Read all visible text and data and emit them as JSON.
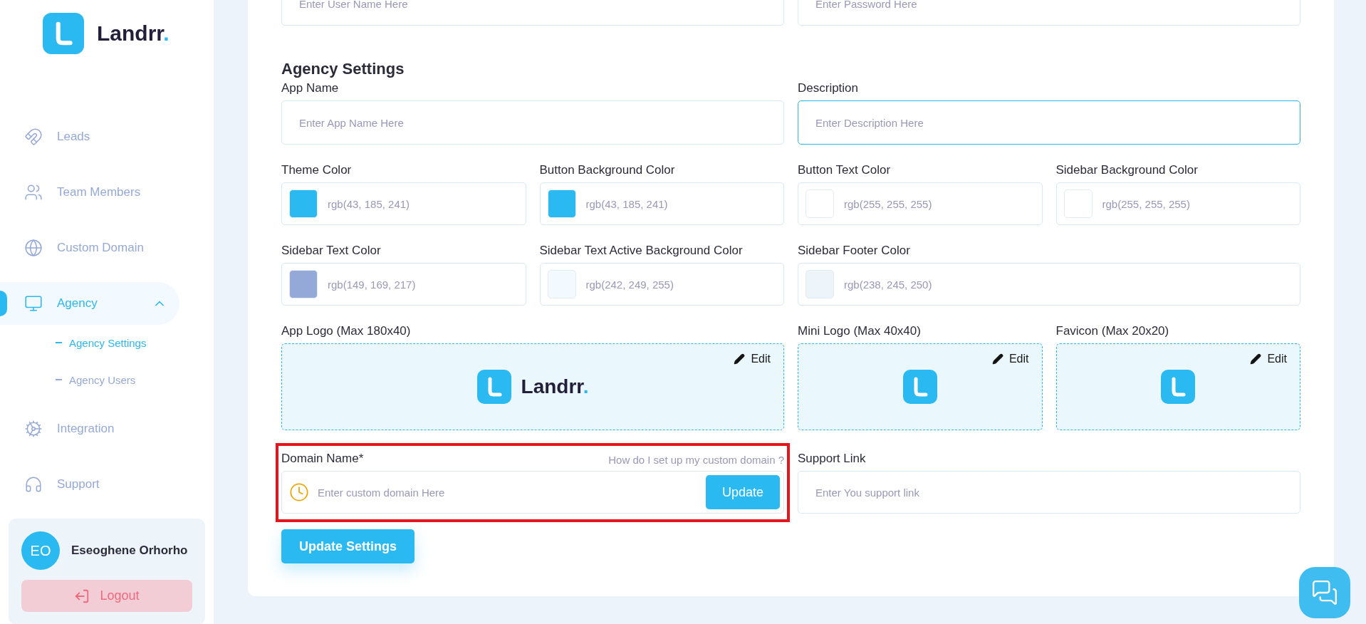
{
  "sidebar": {
    "brand": "Landrr",
    "brand_mark": ".",
    "items": [
      {
        "label": "Leads",
        "selected": false
      },
      {
        "label": "Team Members",
        "selected": false
      },
      {
        "label": "Custom Domain",
        "selected": false
      },
      {
        "label": "Agency",
        "selected": true,
        "expanded": true,
        "children": [
          {
            "label": "Agency Settings",
            "selected": true
          },
          {
            "label": "Agency Users",
            "selected": false
          }
        ]
      },
      {
        "label": "Integration",
        "selected": false
      },
      {
        "label": "Support",
        "selected": false
      }
    ],
    "user": {
      "initials": "EO",
      "name": "Eseoghene Orhorho",
      "logout": "Logout"
    }
  },
  "top_fields": [
    {
      "placeholder": "Enter User Name Here"
    },
    {
      "placeholder": "Enter Password Here"
    }
  ],
  "section_title": "Agency Settings",
  "text_fields": [
    {
      "label": "App Name",
      "placeholder": "Enter App Name Here",
      "focused": false
    },
    {
      "label": "Description",
      "placeholder": "Enter Description Here",
      "focused": true
    }
  ],
  "color_fields": [
    {
      "label": "Theme Color",
      "value": "rgb(43, 185, 241)",
      "color": "#2bb9f1"
    },
    {
      "label": "Button Background Color",
      "value": "rgb(43, 185, 241)",
      "color": "#2bb9f1"
    },
    {
      "label": "Button Text Color",
      "value": "rgb(255, 255, 255)",
      "color": "#ffffff"
    },
    {
      "label": "Sidebar Background Color",
      "value": "rgb(255, 255, 255)",
      "color": "#ffffff"
    },
    {
      "label": "Sidebar Text Color",
      "value": "rgb(149, 169, 217)",
      "color": "#95a9d9"
    },
    {
      "label": "Sidebar Text Active Background Color",
      "value": "rgb(242, 249, 255)",
      "color": "#f2f9ff"
    },
    {
      "label": "Sidebar Footer Color",
      "value": "rgb(238, 245, 250)",
      "color": "#eef5fa"
    }
  ],
  "logo_fields": [
    {
      "label": "App Logo (Max 180x40)",
      "kind": "full",
      "edit": "Edit",
      "brand": "Landrr",
      "brand_mark": "."
    },
    {
      "label": "Mini Logo (Max 40x40)",
      "kind": "mini",
      "edit": "Edit"
    },
    {
      "label": "Favicon (Max 20x20)",
      "kind": "mini",
      "edit": "Edit"
    }
  ],
  "domain_field": {
    "label": "Domain Name*",
    "help_link": "How do I set up my custom domain ?",
    "placeholder": "Enter custom domain Here",
    "button": "Update",
    "highlighted": true
  },
  "support_field": {
    "label": "Support Link",
    "placeholder": "Enter You support link"
  },
  "submit_button": "Update Settings"
}
